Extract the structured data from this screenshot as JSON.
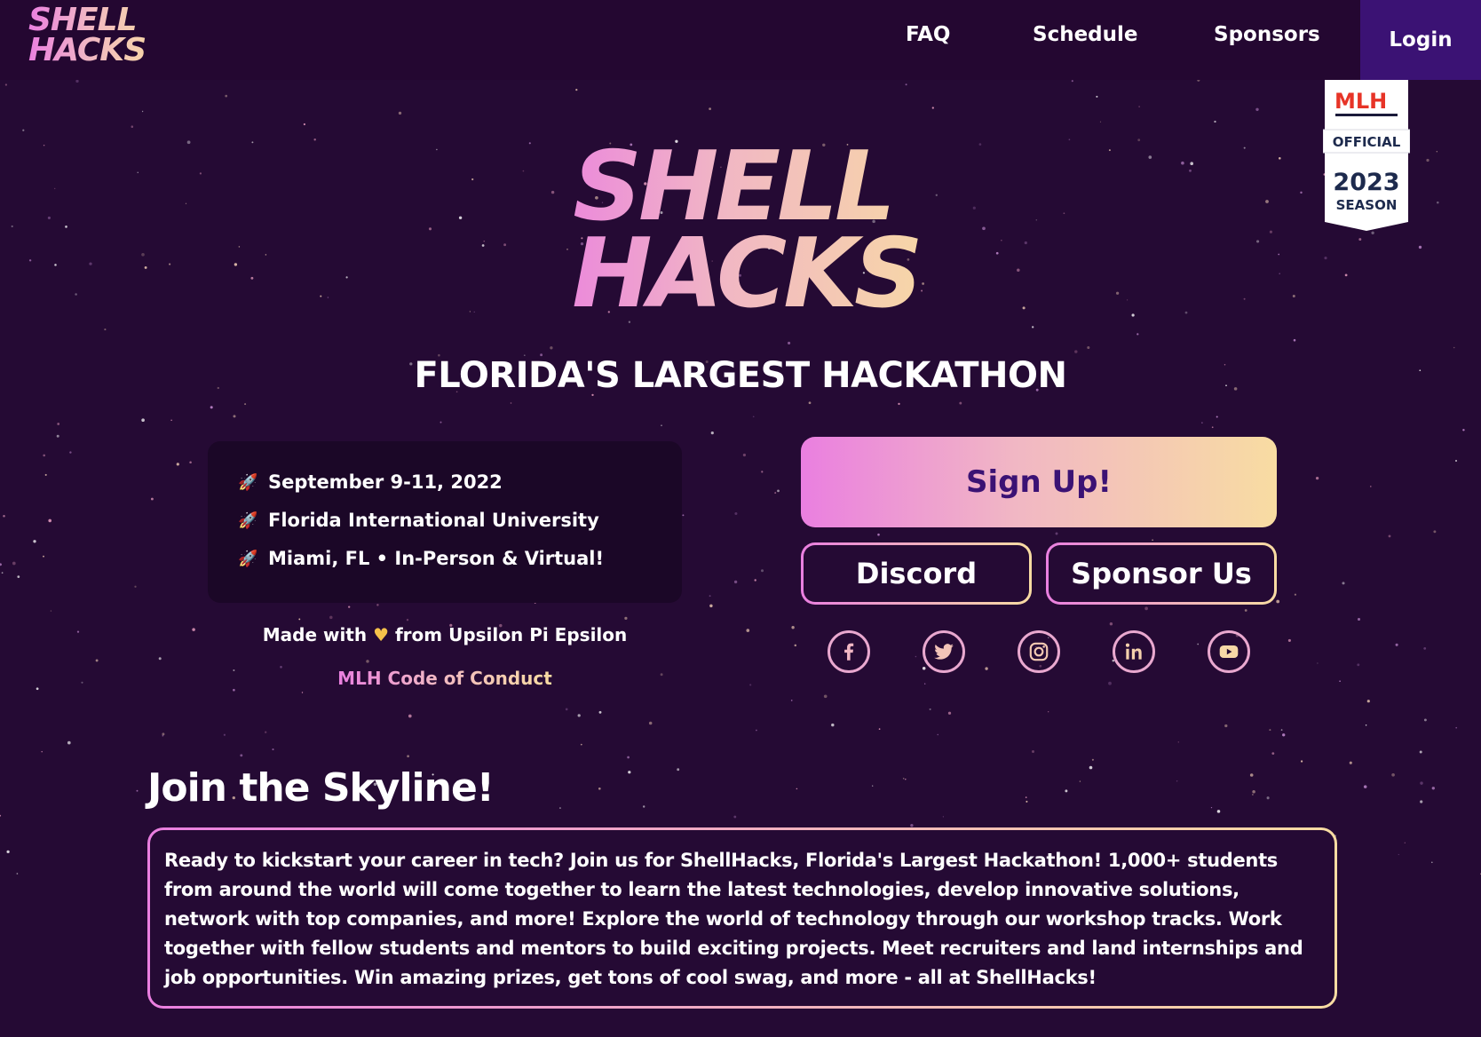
{
  "nav": {
    "logo_line1": "SHELL",
    "logo_line2": "HACKS",
    "links": [
      "FAQ",
      "Schedule",
      "Sponsors"
    ],
    "login": "Login"
  },
  "mlh_badge": {
    "brand": "MLH",
    "official": "OFFICIAL",
    "year": "2023",
    "season": "SEASON"
  },
  "hero": {
    "logo_line1": "SHELL",
    "logo_line2": "HACKS",
    "subtitle": "FLORIDA'S LARGEST HACKATHON"
  },
  "info": {
    "items": [
      "September 9-11, 2022",
      "Florida International University",
      "Miami, FL • In-Person & Virtual!"
    ],
    "made_prefix": "Made with",
    "made_suffix": "from Upsilon Pi Epsilon",
    "code_of_conduct": "MLH Code of Conduct"
  },
  "actions": {
    "signup": "Sign Up!",
    "discord": "Discord",
    "sponsor": "Sponsor Us"
  },
  "socials": [
    "facebook-icon",
    "twitter-icon",
    "instagram-icon",
    "linkedin-icon",
    "youtube-icon"
  ],
  "join": {
    "title": "Join the Skyline!",
    "body": "Ready to kickstart your career in tech? Join us for ShellHacks, Florida's Largest Hackathon! 1,000+ students from around the world will come together to learn the latest technologies, develop innovative solutions, network with top companies, and more! Explore the world of technology through our workshop tracks. Work together with fellow students and mentors to build exciting projects. Meet recruiters and land internships and job opportunities. Win amazing prizes, get tons of cool swag, and more - all at ShellHacks!"
  },
  "colors": {
    "background": "#250a34",
    "nav": "#240731",
    "login_bg": "#3b1274",
    "gradient_start": "#ea7fe0",
    "gradient_end": "#f8dca2"
  }
}
